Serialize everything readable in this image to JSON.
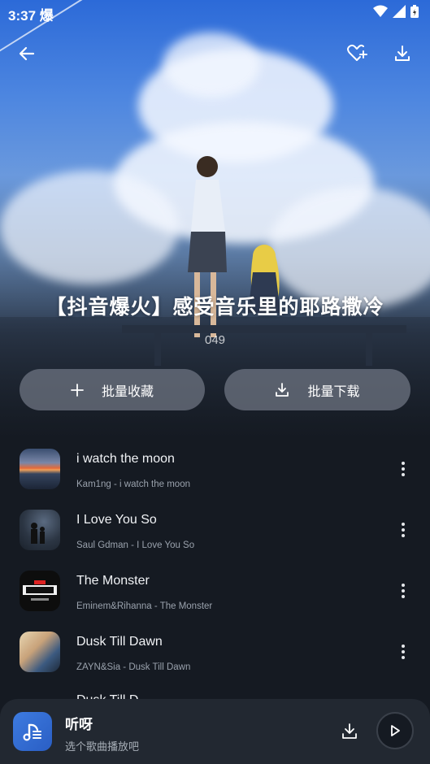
{
  "status": {
    "time": "3:37",
    "notif_glyph": "爆"
  },
  "header": {
    "back_icon": "arrow-left-icon",
    "fav_icon": "heart-plus-icon",
    "download_icon": "download-icon"
  },
  "playlist": {
    "title": "【抖音爆火】感受音乐里的耶路撒冷",
    "count": "049"
  },
  "actions": {
    "collect_label": "批量收藏",
    "download_label": "批量下载"
  },
  "songs": [
    {
      "title": "i watch the moon",
      "subtitle": "Kam1ng - i watch the moon"
    },
    {
      "title": "I Love You So",
      "subtitle": "Saul Gdman - I Love You So"
    },
    {
      "title": "The Monster",
      "subtitle": "Eminem&Rihanna - The Monster"
    },
    {
      "title": "Dusk Till Dawn",
      "subtitle": "ZAYN&Sia - Dusk Till Dawn"
    }
  ],
  "peek_song": {
    "title": "Dusk Till D"
  },
  "player": {
    "title": "听呀",
    "subtitle": "选个歌曲播放吧"
  },
  "colors": {
    "accent": "#2f6fd6",
    "background": "#151a22",
    "button_bg": "#6e7482"
  }
}
